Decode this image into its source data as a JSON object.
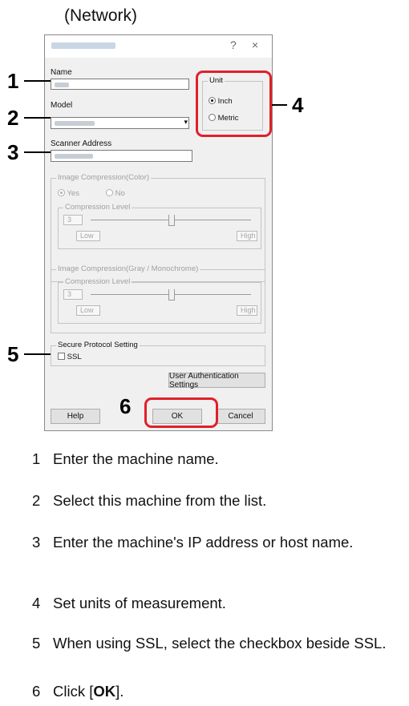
{
  "heading": "(Network)",
  "dialog": {
    "title_bar_controls": [
      "?",
      "×"
    ],
    "name_label": "Name",
    "model_label": "Model",
    "scanner_address_label": "Scanner Address",
    "unit": {
      "title": "Unit",
      "options": [
        "Inch",
        "Metric"
      ],
      "selected": "Inch"
    },
    "image_compression_color": {
      "title": "Image Compression(Color)",
      "options": [
        "Yes",
        "No"
      ],
      "selected": "Yes",
      "level_title": "Compression Level",
      "level_value": "3",
      "low": "Low",
      "high": "High"
    },
    "image_compression_gray": {
      "title": "Image Compression(Gray / Monochrome)",
      "level_title": "Compression Level",
      "level_value": "3",
      "low": "Low",
      "high": "High"
    },
    "secure_protocol": {
      "title": "Secure Protocol Setting",
      "ssl_label": "SSL",
      "ssl_checked": false
    },
    "user_auth_button": "User Authentication Settings",
    "help_button": "Help",
    "ok_button": "OK",
    "cancel_button": "Cancel"
  },
  "callouts": [
    "1",
    "2",
    "3",
    "4",
    "5",
    "6"
  ],
  "steps": [
    {
      "num": "1",
      "text": "Enter the machine name."
    },
    {
      "num": "2",
      "text": "Select this machine from the list."
    },
    {
      "num": "3",
      "text": "Enter the machine's IP address or host name."
    },
    {
      "num": "4",
      "text": "Set units of measurement."
    },
    {
      "num": "5",
      "text": "When using SSL, select the checkbox beside SSL."
    },
    {
      "num": "6",
      "text_before": "Click [",
      "text_bold": "OK",
      "text_after": "]."
    }
  ],
  "colors": {
    "highlight": "#e0202a",
    "dialog_bg": "#f0f0f0"
  }
}
